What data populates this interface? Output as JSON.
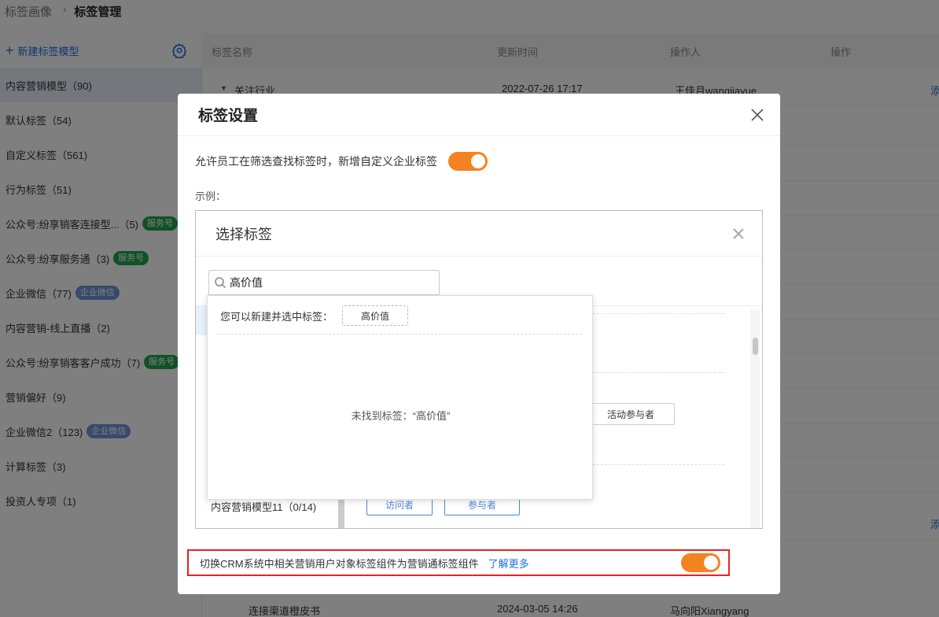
{
  "breadcrumb": {
    "parent": "标签画像",
    "separator": "›",
    "current": "标签管理"
  },
  "sidebar": {
    "new_model_label": "新建标签模型",
    "items": [
      {
        "label": "内容营销模型（90)",
        "badge": "",
        "badge_color": "",
        "active": true
      },
      {
        "label": "默认标签（54)",
        "badge": "",
        "badge_color": ""
      },
      {
        "label": "自定义标签（561)",
        "badge": "",
        "badge_color": ""
      },
      {
        "label": "行为标签（51)",
        "badge": "",
        "badge_color": ""
      },
      {
        "label": "公众号:纷享销客连接型...（5)",
        "badge": "服务号",
        "badge_color": "green"
      },
      {
        "label": "公众号:纷享服务通（3)",
        "badge": "服务号",
        "badge_color": "green"
      },
      {
        "label": "企业微信（77)",
        "badge": "企业微信",
        "badge_color": "blue"
      },
      {
        "label": "内容营销-线上直播（2)",
        "badge": "",
        "badge_color": ""
      },
      {
        "label": "公众号:纷享销客客户成功（7)",
        "badge": "服务号",
        "badge_color": "green"
      },
      {
        "label": "营销偏好（9)",
        "badge": "",
        "badge_color": ""
      },
      {
        "label": "企业微信2（123)",
        "badge": "企业微信",
        "badge_color": "blue"
      },
      {
        "label": "计算标签（3)",
        "badge": "",
        "badge_color": ""
      },
      {
        "label": "投资人专项（1)",
        "badge": "",
        "badge_color": ""
      }
    ]
  },
  "table": {
    "columns": [
      "标签名称",
      "更新时间",
      "操作人",
      "操作"
    ],
    "rows": [
      {
        "name": "关注行业",
        "time": "2022-07-26 17:17",
        "operator": "王佳月wangjiayue",
        "action": "添"
      },
      {
        "name": "",
        "time": "",
        "operator": "",
        "action": "添"
      },
      {
        "name": "连接渠道橙皮书",
        "time": "2024-03-05 14:26",
        "operator": "马向阳Xiangyang",
        "action": ""
      }
    ]
  },
  "modal": {
    "title": "标签设置",
    "allow_label": "允许员工在筛选查找标签时，新增自定义企业标签",
    "allow_enabled": true,
    "example_label": "示例：",
    "example": {
      "title": "选择标签",
      "search_value": "高价值",
      "dropdown_prompt": "您可以新建并选中标签：",
      "dropdown_chip": "高价值",
      "not_found": "未找到标签：“高价值”",
      "tag_activity": "活动参与者",
      "group_label": "内容营销模型11（0/14)",
      "tag_visitor": "访问者",
      "tag_participant": "参与者"
    },
    "crm_label": "切换CRM系统中相关营销用户对象标签组件为营销通标签组件",
    "crm_link": "了解更多",
    "crm_enabled": true
  },
  "colors": {
    "accent": "#1a6fe0",
    "switch_on": "#f58220",
    "highlight_border": "#e62323",
    "badge_green": "#1fa44a",
    "badge_blue": "#6b94d8"
  }
}
